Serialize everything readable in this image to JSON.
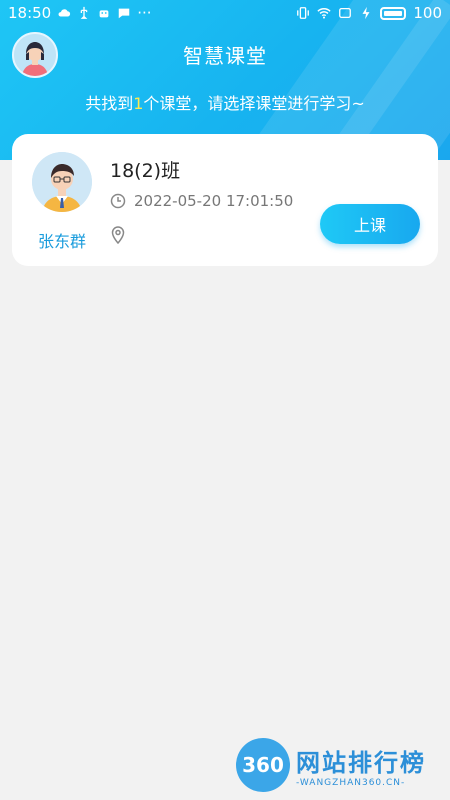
{
  "status_bar": {
    "time": "18:50",
    "more": "···",
    "battery": "100"
  },
  "header": {
    "title": "智慧课堂",
    "subtitle_prefix": "共找到",
    "subtitle_count": "1",
    "subtitle_suffix": "个课堂，请选择课堂进行学习~"
  },
  "classroom_card": {
    "teacher_name": "张东群",
    "class_name": "18(2)班",
    "datetime": "2022-05-20 17:01:50",
    "location": "",
    "start_button_label": "上课"
  },
  "watermark": {
    "logo_text": "360",
    "main_text": "网站排行榜",
    "sub_text": "-WANGZHAN360.CN-"
  },
  "colors": {
    "accent": "#18a8ef",
    "highlight": "#ffe94d",
    "teacher_name": "#1a9cdc"
  },
  "icons": {
    "clock": "clock-icon",
    "location": "location-pin-icon"
  }
}
